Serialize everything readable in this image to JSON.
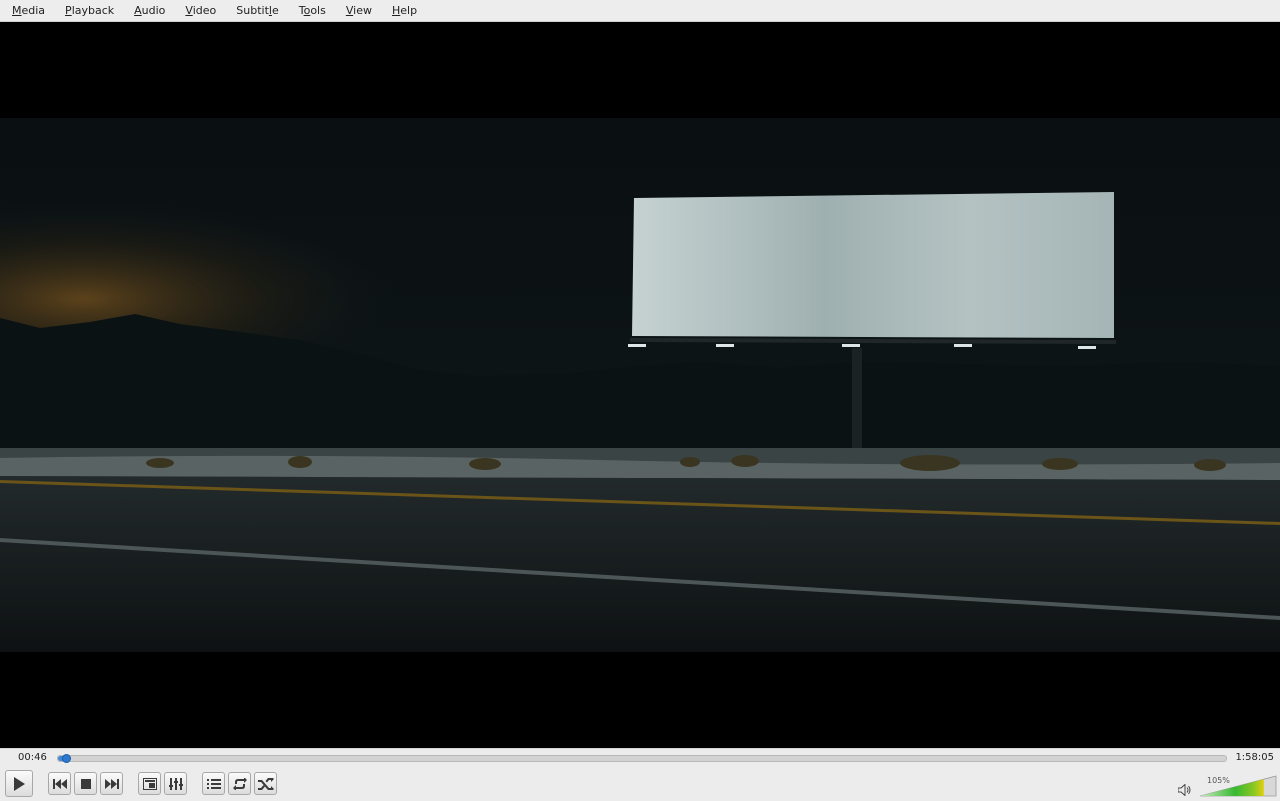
{
  "menu": {
    "items": [
      {
        "label": "Media",
        "mnemonic_index": 0
      },
      {
        "label": "Playback",
        "mnemonic_index": 0
      },
      {
        "label": "Audio",
        "mnemonic_index": 0
      },
      {
        "label": "Video",
        "mnemonic_index": 0
      },
      {
        "label": "Subtitle",
        "mnemonic_index": 6
      },
      {
        "label": "Tools",
        "mnemonic_index": 1
      },
      {
        "label": "View",
        "mnemonic_index": 0
      },
      {
        "label": "Help",
        "mnemonic_index": 0
      }
    ]
  },
  "player": {
    "elapsed": "00:46",
    "total": "1:58:05",
    "progress": 0.0065
  },
  "controls": {
    "buttons": [
      {
        "name": "play-button",
        "icon": "play-icon"
      },
      {
        "name": "previous-button",
        "icon": "skip-previous-icon"
      },
      {
        "name": "stop-button",
        "icon": "stop-icon"
      },
      {
        "name": "next-button",
        "icon": "skip-next-icon"
      },
      {
        "name": "fullscreen-button",
        "icon": "fullscreen-icon"
      },
      {
        "name": "extended-settings-button",
        "icon": "equalizer-icon"
      },
      {
        "name": "playlist-button",
        "icon": "playlist-icon"
      },
      {
        "name": "loop-button",
        "icon": "loop-icon"
      },
      {
        "name": "shuffle-button",
        "icon": "shuffle-icon"
      }
    ]
  },
  "volume": {
    "level_percent": "105%",
    "level": 1.05
  },
  "colors": {
    "seek_accent": "#3f89d6",
    "volume_green": "#38b832",
    "volume_yellow": "#e0d010"
  }
}
